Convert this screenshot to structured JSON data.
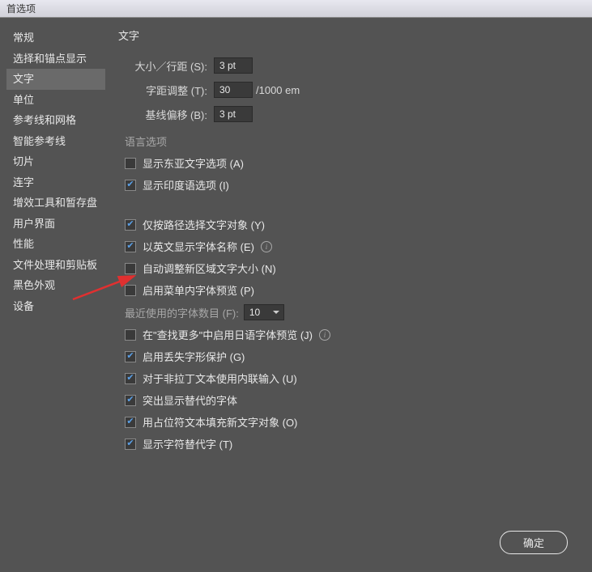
{
  "window": {
    "title": "首选项"
  },
  "sidebar": {
    "items": [
      {
        "label": "常规"
      },
      {
        "label": "选择和锚点显示"
      },
      {
        "label": "文字",
        "active": true
      },
      {
        "label": "单位"
      },
      {
        "label": "参考线和网格"
      },
      {
        "label": "智能参考线"
      },
      {
        "label": "切片"
      },
      {
        "label": "连字"
      },
      {
        "label": "增效工具和暂存盘"
      },
      {
        "label": "用户界面"
      },
      {
        "label": "性能"
      },
      {
        "label": "文件处理和剪贴板"
      },
      {
        "label": "黑色外观"
      },
      {
        "label": "设备"
      }
    ]
  },
  "main": {
    "heading": "文字",
    "size_label": "大小／行距 (S):",
    "size_value": "3 pt",
    "tracking_label": "字距调整 (T):",
    "tracking_value": "30",
    "tracking_unit": "/1000 em",
    "baseline_label": "基线偏移 (B):",
    "baseline_value": "3 pt",
    "lang_group": "语言选项",
    "checkboxes": {
      "east_asian": {
        "label": "显示东亚文字选项 (A)",
        "checked": false
      },
      "indic": {
        "label": "显示印度语选项 (I)",
        "checked": true
      },
      "path_select": {
        "label": "仅按路径选择文字对象 (Y)",
        "checked": true
      },
      "english_font": {
        "label": "以英文显示字体名称 (E)",
        "checked": true
      },
      "auto_size": {
        "label": "自动调整新区域文字大小 (N)",
        "checked": false
      },
      "menu_preview": {
        "label": "启用菜单内字体预览 (P)",
        "checked": false
      },
      "jp_preview": {
        "label": "在\"查找更多\"中启用日语字体预览 (J)",
        "checked": false
      },
      "glyph_protect": {
        "label": "启用丢失字形保护 (G)",
        "checked": true
      },
      "inline_input": {
        "label": "对于非拉丁文本使用内联输入 (U)",
        "checked": true
      },
      "alt_highlight": {
        "label": "突出显示替代的字体",
        "checked": true
      },
      "placeholder_fill": {
        "label": "用占位符文本填充新文字对象 (O)",
        "checked": true
      },
      "alt_glyph": {
        "label": "显示字符替代字 (T)",
        "checked": true
      }
    },
    "recent_fonts_label": "最近使用的字体数目 (F):",
    "recent_fonts_value": "10",
    "ok_button": "确定"
  }
}
